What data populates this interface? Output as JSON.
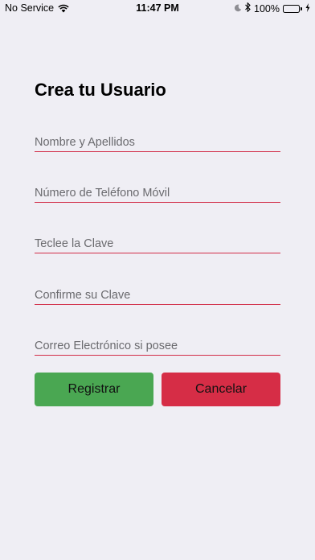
{
  "status_bar": {
    "carrier": "No Service",
    "time": "11:47 PM",
    "battery": "100%",
    "icons": [
      "wifi-icon",
      "moon-icon",
      "bluetooth-icon",
      "battery-icon",
      "charging-bolt-icon"
    ]
  },
  "form": {
    "title": "Crea tu Usuario",
    "fields": [
      {
        "name": "full-name-field",
        "placeholder": "Nombre y Apellidos",
        "value": ""
      },
      {
        "name": "phone-field",
        "placeholder": "Número de Teléfono Móvil",
        "value": ""
      },
      {
        "name": "password-field",
        "placeholder": "Teclee la Clave",
        "value": ""
      },
      {
        "name": "confirm-password-field",
        "placeholder": "Confirme su Clave",
        "value": ""
      },
      {
        "name": "email-field",
        "placeholder": "Correo Electrónico si posee",
        "value": ""
      }
    ],
    "register_label": "Registrar",
    "cancel_label": "Cancelar"
  },
  "colors": {
    "background": "#efeef4",
    "field_underline": "#d22e48",
    "register_button": "#4aa752",
    "cancel_button": "#d62d46"
  }
}
